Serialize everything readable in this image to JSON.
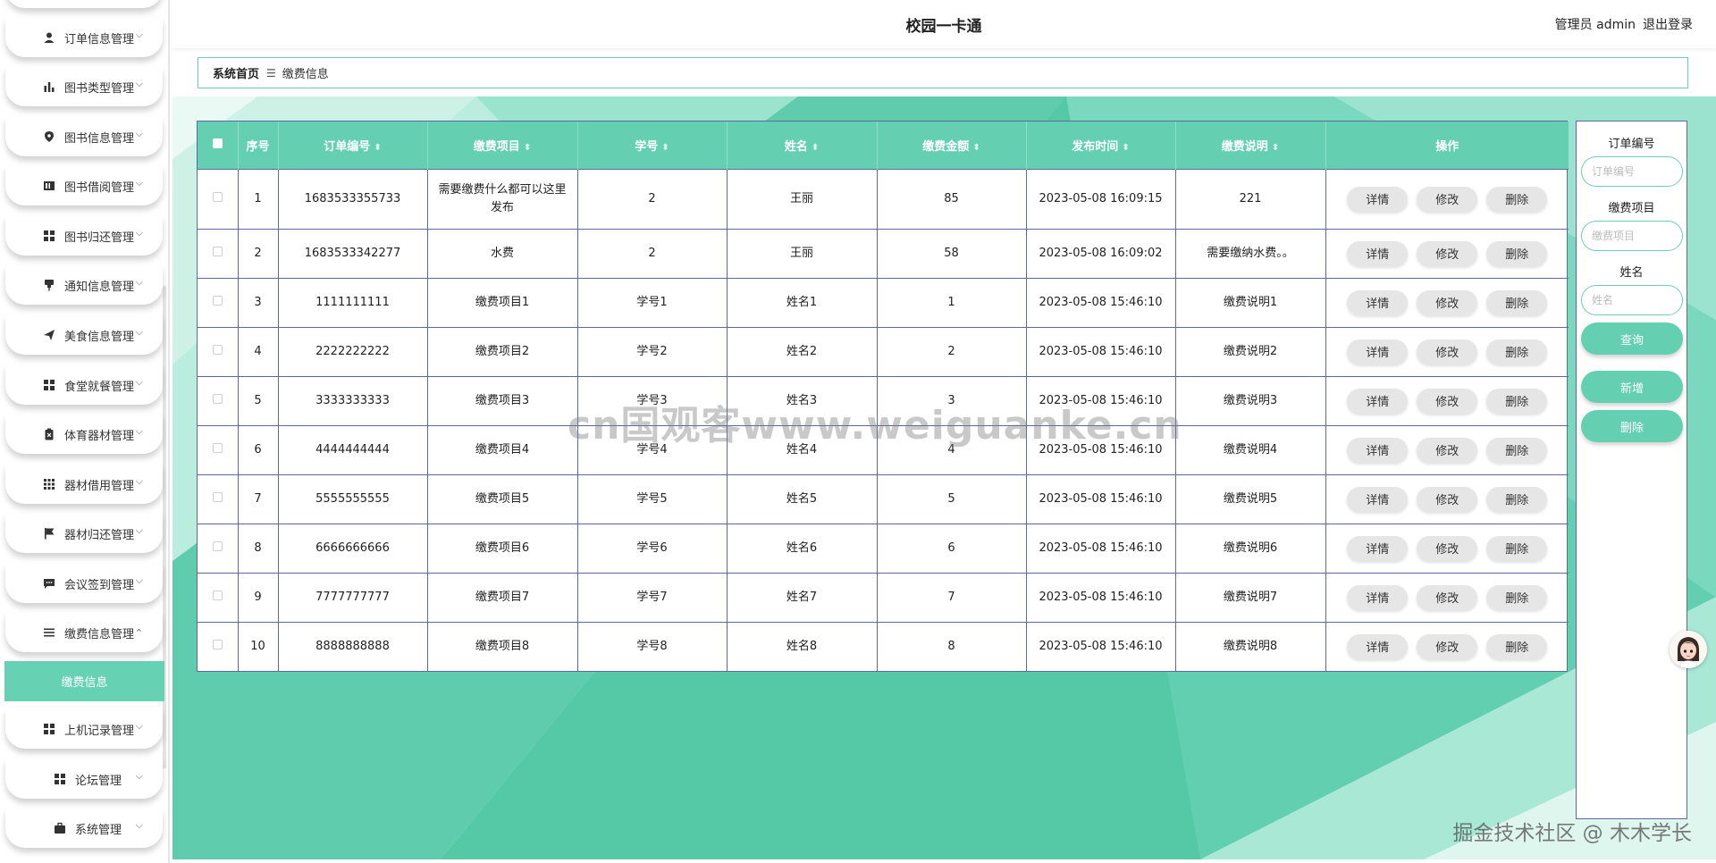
{
  "app": {
    "title": "校园一卡通"
  },
  "user": {
    "role_label": "管理员 admin",
    "logout_label": "退出登录"
  },
  "sidebar": {
    "items": [
      {
        "label": "订单信息管理",
        "icon": "user-icon",
        "expanded": false
      },
      {
        "label": "图书类型管理",
        "icon": "bar-chart-icon",
        "expanded": false
      },
      {
        "label": "图书信息管理",
        "icon": "location-pin-icon",
        "expanded": false
      },
      {
        "label": "图书借阅管理",
        "icon": "book-icon",
        "expanded": false
      },
      {
        "label": "图书归还管理",
        "icon": "grid-icon",
        "expanded": false
      },
      {
        "label": "通知信息管理",
        "icon": "pin-icon",
        "expanded": false
      },
      {
        "label": "美食信息管理",
        "icon": "paper-plane-icon",
        "expanded": false
      },
      {
        "label": "食堂就餐管理",
        "icon": "grid-icon",
        "expanded": false
      },
      {
        "label": "体育器材管理",
        "icon": "clipboard-icon",
        "expanded": false
      },
      {
        "label": "器材借用管理",
        "icon": "grid-dots-icon",
        "expanded": false
      },
      {
        "label": "器材归还管理",
        "icon": "flag-icon",
        "expanded": false
      },
      {
        "label": "会议签到管理",
        "icon": "chat-icon",
        "expanded": false
      },
      {
        "label": "缴费信息管理",
        "icon": "list-icon",
        "expanded": true
      },
      {
        "label": "上机记录管理",
        "icon": "grid-icon",
        "expanded": false
      },
      {
        "label": "论坛管理",
        "icon": "grid-icon",
        "expanded": false
      },
      {
        "label": "系统管理",
        "icon": "briefcase-icon",
        "expanded": false
      }
    ],
    "active_subitem": "缴费信息",
    "arrow_down": "⌵",
    "arrow_up": "⌃"
  },
  "breadcrumb": {
    "home": "系统首页",
    "separator": "☰",
    "current": "缴费信息"
  },
  "table": {
    "columns": [
      {
        "label": "",
        "sortable": false
      },
      {
        "label": "序号",
        "sortable": false
      },
      {
        "label": "订单编号",
        "sortable": true
      },
      {
        "label": "缴费项目",
        "sortable": true
      },
      {
        "label": "学号",
        "sortable": true
      },
      {
        "label": "姓名",
        "sortable": true
      },
      {
        "label": "缴费金额",
        "sortable": true
      },
      {
        "label": "发布时间",
        "sortable": true
      },
      {
        "label": "缴费说明",
        "sortable": true
      },
      {
        "label": "操作",
        "sortable": false
      }
    ],
    "sort_glyph": "⬍",
    "rows": [
      [
        "1",
        "1683533355733",
        "需要缴费什么都可以这里发布",
        "2",
        "王丽",
        "85",
        "2023-05-08 16:09:15",
        "221"
      ],
      [
        "2",
        "1683533342277",
        "水费",
        "2",
        "王丽",
        "58",
        "2023-05-08 16:09:02",
        "需要缴纳水费。。"
      ],
      [
        "3",
        "1111111111",
        "缴费项目1",
        "学号1",
        "姓名1",
        "1",
        "2023-05-08 15:46:10",
        "缴费说明1"
      ],
      [
        "4",
        "2222222222",
        "缴费项目2",
        "学号2",
        "姓名2",
        "2",
        "2023-05-08 15:46:10",
        "缴费说明2"
      ],
      [
        "5",
        "3333333333",
        "缴费项目3",
        "学号3",
        "姓名3",
        "3",
        "2023-05-08 15:46:10",
        "缴费说明3"
      ],
      [
        "6",
        "4444444444",
        "缴费项目4",
        "学号4",
        "姓名4",
        "4",
        "2023-05-08 15:46:10",
        "缴费说明4"
      ],
      [
        "7",
        "5555555555",
        "缴费项目5",
        "学号5",
        "姓名5",
        "5",
        "2023-05-08 15:46:10",
        "缴费说明5"
      ],
      [
        "8",
        "6666666666",
        "缴费项目6",
        "学号6",
        "姓名6",
        "6",
        "2023-05-08 15:46:10",
        "缴费说明6"
      ],
      [
        "9",
        "7777777777",
        "缴费项目7",
        "学号7",
        "姓名7",
        "7",
        "2023-05-08 15:46:10",
        "缴费说明7"
      ],
      [
        "10",
        "8888888888",
        "缴费项目8",
        "学号8",
        "姓名8",
        "8",
        "2023-05-08 15:46:10",
        "缴费说明8"
      ]
    ],
    "row_actions": [
      "详情",
      "修改",
      "删除"
    ]
  },
  "search": {
    "order_no": {
      "label": "订单编号",
      "placeholder": "订单编号",
      "value": ""
    },
    "item": {
      "label": "缴费项目",
      "placeholder": "缴费项目",
      "value": ""
    },
    "name": {
      "label": "姓名",
      "placeholder": "姓名",
      "value": ""
    },
    "query_label": "查询",
    "add_label": "新增",
    "delete_label": "删除"
  },
  "overlays": {
    "watermark": "cn国观客www.weiguanke.cn",
    "footer_mark": "掘金技术社区 @ 木木学长"
  },
  "colors": {
    "accent": "#64d0b1",
    "border": "#5d6aa0",
    "button_gray": "#e6e6e6"
  }
}
